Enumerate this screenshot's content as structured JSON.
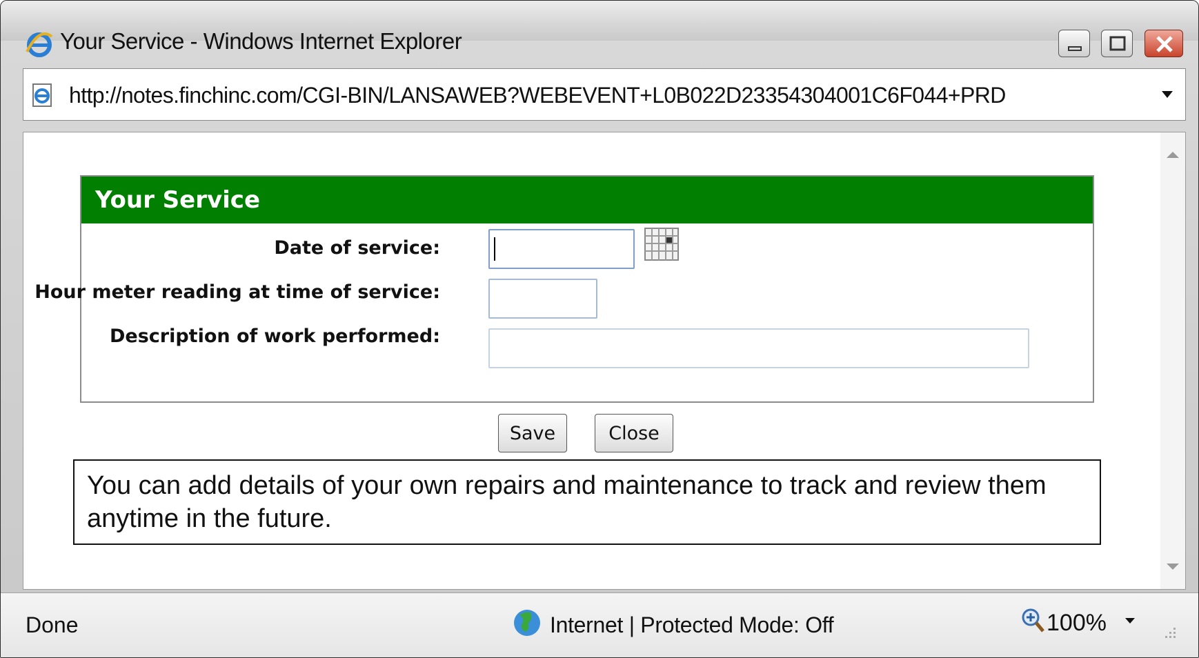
{
  "window": {
    "title": "Your Service - Windows Internet Explorer",
    "icon": "ie-icon",
    "controls": [
      "minimize-icon",
      "maximize-icon",
      "close-icon"
    ]
  },
  "address_bar": {
    "url": "http://notes.finchinc.com/CGI-BIN/LANSAWEB?WEBEVENT+L0B022D23354304001C6F044+PRD"
  },
  "form": {
    "header": "Your Service",
    "header_color": "#007f00",
    "fields": {
      "date_label": "Date of service:",
      "date_value": "",
      "hour_label": "Hour meter reading at time of service:",
      "hour_value": "",
      "desc_label": "Description of work performed:",
      "desc_value": ""
    },
    "buttons": {
      "save": "Save",
      "close": "Close"
    }
  },
  "note": {
    "text": "You can add details of your own repairs and maintenance to track and review them anytime in the future."
  },
  "status_bar": {
    "status": "Done",
    "zone": "Internet | Protected Mode: Off",
    "zoom": "100%"
  }
}
